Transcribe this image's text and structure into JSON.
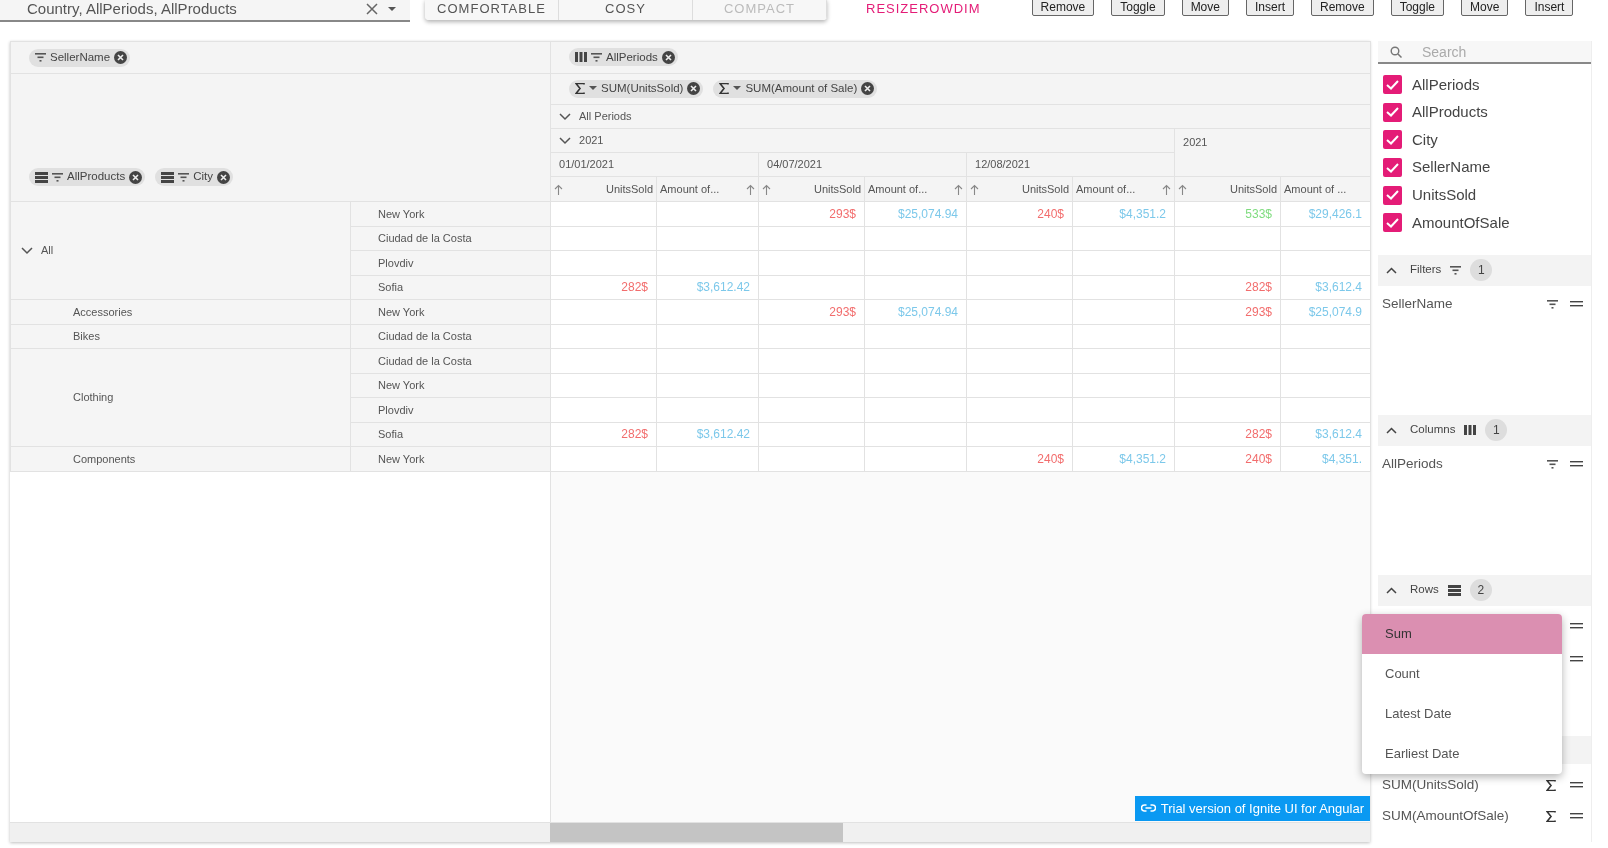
{
  "toolbar": {
    "select": {
      "value": "Country, AllPeriods, AllProducts"
    },
    "density_buttons": [
      {
        "label": "COMFORTABLE",
        "disabled": false
      },
      {
        "label": "COSY",
        "disabled": false
      },
      {
        "label": "COMPACT",
        "disabled": true
      }
    ],
    "link_button": "RESIZEROWDIM",
    "buttons": [
      "Remove",
      "Toggle",
      "Move",
      "Insert",
      "Remove",
      "Toggle",
      "Move",
      "Insert"
    ]
  },
  "pivot": {
    "filter_chips": [
      {
        "label": "SellerName",
        "kind": "filter"
      }
    ],
    "column_chips": [
      {
        "label": "AllPeriods",
        "kind": "column"
      }
    ],
    "value_chips": [
      {
        "label": "SUM(UnitsSold)",
        "kind": "value"
      },
      {
        "label": "SUM(Amount of Sale)",
        "kind": "value"
      }
    ],
    "row_chips": [
      {
        "label": "AllProducts",
        "kind": "row"
      },
      {
        "label": "City",
        "kind": "row"
      }
    ],
    "column_header": {
      "all": {
        "label": "All Periods",
        "expanded": true
      },
      "year": {
        "label": "2021",
        "expanded": true
      },
      "dates": [
        "01/01/2021",
        "04/07/2021",
        "12/08/2021"
      ],
      "total": "2021",
      "measures": [
        {
          "label": "UnitsSold",
          "kind": "units"
        },
        {
          "label": "Amount of...",
          "kind": "amount"
        },
        {
          "label": "UnitsSold",
          "kind": "units"
        },
        {
          "label": "Amount of...",
          "kind": "amount"
        },
        {
          "label": "UnitsSold",
          "kind": "units"
        },
        {
          "label": "Amount of...",
          "kind": "amount"
        },
        {
          "label": "UnitsSold",
          "kind": "units"
        },
        {
          "label": "Amount of ...",
          "kind": "cut"
        }
      ]
    },
    "groups": [
      {
        "label": "All",
        "kind": "total",
        "expanded": true,
        "rows": [
          {
            "city": "New York",
            "cells": [
              null,
              null,
              {
                "text": "293$",
                "color": "#f26d6d"
              },
              {
                "text": "$25,074.94",
                "color": "#7cc8ea"
              },
              {
                "text": "240$",
                "color": "#f26d6d"
              },
              {
                "text": "$4,351.2",
                "color": "#7cc8ea"
              },
              {
                "text": "533$",
                "color": "#7fdc7f"
              },
              {
                "text": "$29,426.1",
                "color": "#7cc8ea"
              }
            ]
          },
          {
            "city": "Ciudad de la Costa",
            "cells": [
              null,
              null,
              null,
              null,
              null,
              null,
              null,
              null
            ]
          },
          {
            "city": "Plovdiv",
            "cells": [
              null,
              null,
              null,
              null,
              null,
              null,
              null,
              null
            ]
          },
          {
            "city": "Sofia",
            "cells": [
              {
                "text": "282$",
                "color": "#f26d6d"
              },
              {
                "text": "$3,612.42",
                "color": "#7cc8ea"
              },
              null,
              null,
              null,
              null,
              {
                "text": "282$",
                "color": "#f26d6d"
              },
              {
                "text": "$3,612.4",
                "color": "#7cc8ea"
              }
            ]
          }
        ]
      },
      {
        "label": "Accessories",
        "kind": "member",
        "rows": [
          {
            "city": "New York",
            "cells": [
              null,
              null,
              {
                "text": "293$",
                "color": "#f26d6d"
              },
              {
                "text": "$25,074.94",
                "color": "#7cc8ea"
              },
              null,
              null,
              {
                "text": "293$",
                "color": "#f26d6d"
              },
              {
                "text": "$25,074.9",
                "color": "#7cc8ea"
              }
            ]
          }
        ]
      },
      {
        "label": "Bikes",
        "kind": "member",
        "rows": [
          {
            "city": "Ciudad de la Costa",
            "cells": [
              null,
              null,
              null,
              null,
              null,
              null,
              null,
              null
            ]
          }
        ]
      },
      {
        "label": "Clothing",
        "kind": "member",
        "rows": [
          {
            "city": "Ciudad de la Costa",
            "cells": [
              null,
              null,
              null,
              null,
              null,
              null,
              null,
              null
            ]
          },
          {
            "city": "New York",
            "cells": [
              null,
              null,
              null,
              null,
              null,
              null,
              null,
              null
            ]
          },
          {
            "city": "Plovdiv",
            "cells": [
              null,
              null,
              null,
              null,
              null,
              null,
              null,
              null
            ]
          },
          {
            "city": "Sofia",
            "cells": [
              {
                "text": "282$",
                "color": "#f26d6d"
              },
              {
                "text": "$3,612.42",
                "color": "#7cc8ea"
              },
              null,
              null,
              null,
              null,
              {
                "text": "282$",
                "color": "#f26d6d"
              },
              {
                "text": "$3,612.4",
                "color": "#7cc8ea"
              }
            ]
          }
        ]
      },
      {
        "label": "Components",
        "kind": "member",
        "rows": [
          {
            "city": "New York",
            "cells": [
              null,
              null,
              null,
              null,
              {
                "text": "240$",
                "color": "#f26d6d"
              },
              {
                "text": "$4,351.2",
                "color": "#7cc8ea"
              },
              {
                "text": "240$",
                "color": "#f26d6d"
              },
              {
                "text": "$4,351.",
                "color": "#7cc8ea"
              }
            ]
          }
        ]
      }
    ]
  },
  "trial_badge": "Trial version of Ignite UI for Angular",
  "selector": {
    "search": {
      "placeholder": "Search"
    },
    "fields": [
      {
        "label": "AllPeriods",
        "checked": true
      },
      {
        "label": "AllProducts",
        "checked": true
      },
      {
        "label": "City",
        "checked": true
      },
      {
        "label": "SellerName",
        "checked": true
      },
      {
        "label": "UnitsSold",
        "checked": true
      },
      {
        "label": "AmountOfSale",
        "checked": true
      }
    ],
    "sections": [
      {
        "label": "Filters",
        "kind": "filters",
        "count": "1",
        "expanded": true,
        "items": [
          {
            "label": "SellerName",
            "kind": "filter"
          }
        ]
      },
      {
        "label": "Columns",
        "kind": "columns",
        "count": "1",
        "expanded": true,
        "items": [
          {
            "label": "AllPeriods",
            "kind": "filter"
          }
        ]
      },
      {
        "label": "Rows",
        "kind": "rows",
        "count": "2",
        "expanded": true,
        "items": [
          {
            "kind": "covered"
          },
          {
            "kind": "covered"
          }
        ]
      },
      {
        "kind": "covered",
        "items": [
          {
            "label": "SUM(UnitsSold)",
            "kind": "sum"
          },
          {
            "label": "SUM(AmountOfSale)",
            "kind": "sum"
          }
        ]
      }
    ]
  },
  "aggregate_menu": [
    {
      "label": "Sum",
      "selected": true
    },
    {
      "label": "Count",
      "selected": false
    },
    {
      "label": "Latest Date",
      "selected": false
    },
    {
      "label": "Earliest Date",
      "selected": false
    }
  ]
}
